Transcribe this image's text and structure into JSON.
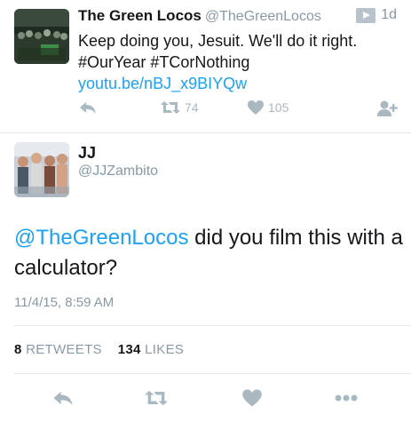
{
  "top_tweet": {
    "name": "The Green Locos",
    "handle": "@TheGreenLocos",
    "time": "1d",
    "text_plain": "Keep doing you, Jesuit. We'll do it right. #OurYear #TCorNothing ",
    "text_link": "youtu.be/nBJ_x9BIYQw",
    "retweets": "74",
    "likes": "105"
  },
  "main_tweet": {
    "name": "JJ",
    "handle": "@JJZambito",
    "mention": "@TheGreenLocos",
    "text": " did you film this with a calculator?",
    "timestamp": "11/4/15, 8:59 AM",
    "retweet_count": "8",
    "retweet_label": "RETWEETS",
    "like_count": "134",
    "like_label": "LIKES"
  },
  "colors": {
    "link": "#1da1f2",
    "muted": "#8899a6",
    "icon": "#aab8c2"
  }
}
